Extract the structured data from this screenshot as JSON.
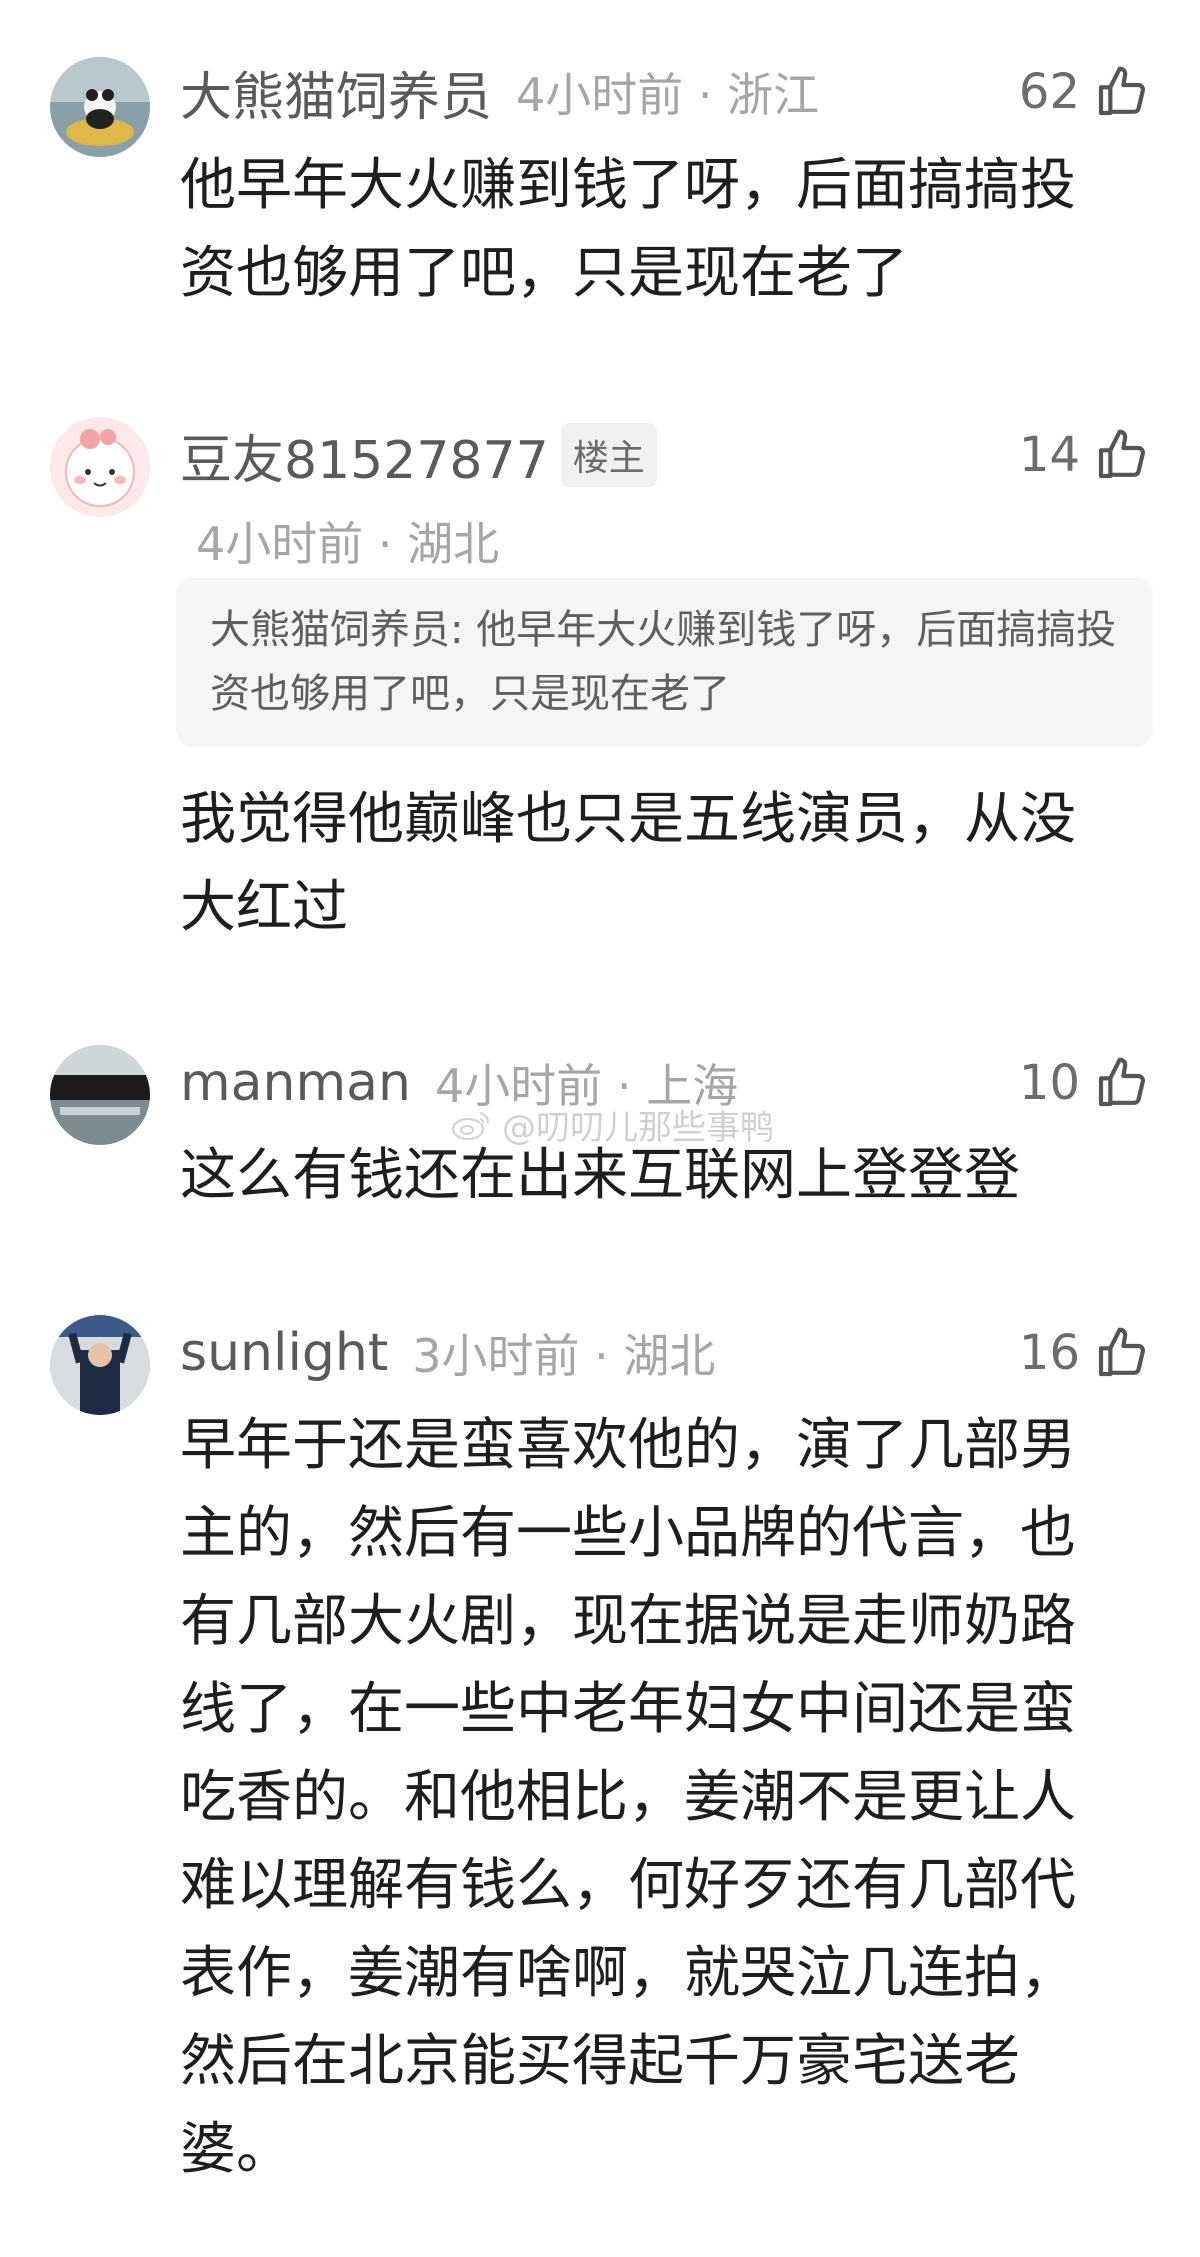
{
  "comments": [
    {
      "username": "大熊猫饲养员",
      "time": "4小时前",
      "location": "浙江",
      "likes": "62",
      "body": "他早年大火赚到钱了呀，后面搞搞投资也够用了吧，只是现在老了"
    },
    {
      "username": "豆友81527877",
      "badge": "楼主",
      "time": "4小时前",
      "location": "湖北",
      "likes": "14",
      "quote": "大熊猫饲养员: 他早年大火赚到钱了呀，后面搞搞投资也够用了吧，只是现在老了",
      "body": "我觉得他巅峰也只是五线演员，从没大红过"
    },
    {
      "username": "manman",
      "time": "4小时前",
      "location": "上海",
      "likes": "10",
      "body": "这么有钱还在出来互联网上登登登"
    },
    {
      "username": "sunlight",
      "time": "3小时前",
      "location": "湖北",
      "likes": "16",
      "body": "早年于还是蛮喜欢他的，演了几部男主的，然后有一些小品牌的代言，也有几部大火剧，现在据说是走师奶路线了，在一些中老年妇女中间还是蛮吃香的。和他相比，姜潮不是更让人难以理解有钱么，何好歹还有几部代表作，姜潮有啥啊，就哭泣几连拍，然后在北京能买得起千万豪宅送老婆。"
    }
  ],
  "separator": "·",
  "watermark": "@叨叨儿那些事鸭",
  "icons": {
    "like": "thumbs-up-icon",
    "watermark": "weibo-icon"
  }
}
